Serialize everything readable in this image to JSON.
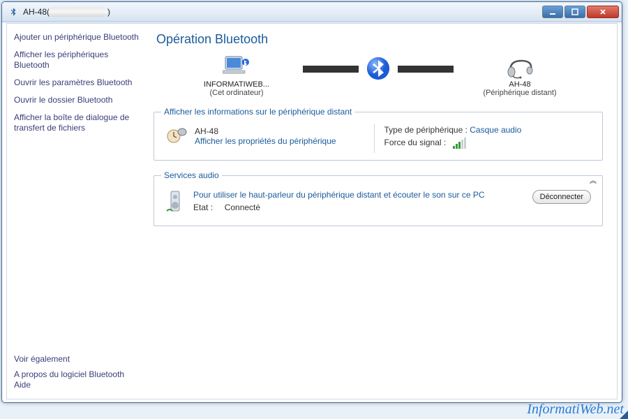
{
  "window": {
    "title_prefix": "AH-48(",
    "title_suffix": ")"
  },
  "sidebar": {
    "links": [
      "Ajouter un périphérique Bluetooth",
      "Afficher les périphériques Bluetooth",
      "Ouvrir les paramètres Bluetooth",
      "Ouvrir le dossier Bluetooth",
      "Afficher la boîte de dialogue de transfert de fichiers"
    ],
    "see_also": "Voir également",
    "footer": [
      "A propos du logiciel Bluetooth",
      "Aide"
    ]
  },
  "main": {
    "title": "Opération Bluetooth",
    "this_pc": {
      "name": "INFORMATIWEB...",
      "sub": "(Cet ordinateur)"
    },
    "remote": {
      "name": "AH-48",
      "sub": "(Périphérique distant)"
    }
  },
  "info_group": {
    "legend": "Afficher les informations sur le périphérique distant",
    "device_name": "AH-48",
    "properties_link": "Afficher les propriétés du périphérique",
    "type_label": "Type de périphérique :",
    "type_value": "Casque audio",
    "signal_label": "Force du signal :"
  },
  "services_group": {
    "legend": "Services audio",
    "desc_link": "Pour utiliser le haut-parleur du périphérique distant et écouter le son sur ce PC",
    "status_label": "Etat :",
    "status_value": "Connecté",
    "disconnect": "Déconnecter"
  },
  "watermark": "InformatiWeb.net"
}
